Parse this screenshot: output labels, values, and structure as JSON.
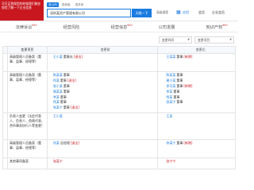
{
  "header": {
    "logo_text": "可可买到保险的时候我们能在保险了解一下企业信息",
    "search_tabs": [
      "查公司",
      "查老板",
      "查关系"
    ],
    "search_value": "深圳某资产管理有限公司",
    "search_button": "天眼一下",
    "advanced": "高级搜索",
    "links": [
      "应用",
      "会员",
      "企业会员"
    ]
  },
  "nav": {
    "items": [
      {
        "label": "法律诉讼",
        "count": "99+"
      },
      {
        "label": "经营风险",
        "count": ""
      },
      {
        "label": "经营信息",
        "count": "99+"
      },
      {
        "label": "公司发展",
        "count": ""
      },
      {
        "label": "知识产权",
        "count": "99+"
      }
    ]
  },
  "toolbar": {
    "filter1": "变更时间",
    "filter2": "变更项目"
  },
  "table": {
    "headers": [
      "",
      "变更项目",
      "变更前",
      "变更后"
    ],
    "rows": [
      {
        "type": "高级管理人员备案（董事、监事、经理等）",
        "before": [
          {
            "name": "王小某",
            "role": "董事长",
            "tag": "[退出]"
          }
        ],
        "after": [
          {
            "name": "王某某",
            "role": "董事",
            "tag": "[新增]"
          }
        ]
      },
      {
        "type": "高级管理人员备案（董事、监事、经理等）",
        "before": [
          {
            "name": "陈某某",
            "role": "董事",
            "tag": ""
          },
          {
            "name": "徐某",
            "role": "董事",
            "tag": "[退出]"
          },
          {
            "name": "张小某",
            "role": "董事",
            "tag": ""
          },
          {
            "name": "谢某某",
            "role": "董事",
            "tag": ""
          },
          {
            "name": "李某",
            "role": "董事",
            "tag": ""
          },
          {
            "name": "钱某",
            "role": "董事",
            "tag": ""
          },
          {
            "name": "张某宁",
            "role": "董事",
            "tag": "[退出]"
          }
        ],
        "after": [
          {
            "name": "陈某某",
            "role": "董事",
            "tag": ""
          },
          {
            "name": "谢小某",
            "role": "董事",
            "tag": ""
          },
          {
            "name": "徐可某",
            "role": "董事",
            "tag": "[新增]"
          },
          {
            "name": "李某",
            "role": "董事",
            "tag": ""
          },
          {
            "name": "钱某",
            "role": "董事",
            "tag": ""
          },
          {
            "name": "张某宁",
            "role": "董事",
            "tag": ""
          }
        ]
      },
      {
        "type": "负责人变更（法定代表人、负责人、首席代表、合伙事务执行人等变更）",
        "before": [
          {
            "name": "王小某",
            "role": "",
            "tag": ""
          }
        ],
        "after": [
          {
            "name": "王某",
            "role": "",
            "tag": ""
          }
        ]
      },
      {
        "type": "高级管理人员备案（董事、监事、经理等）",
        "before": [
          {
            "name": "徐某",
            "role": "总经理",
            "tag": "[退出]"
          }
        ],
        "after": [
          {
            "name": "李某宁",
            "role": "董事",
            "tag": "[新增]"
          }
        ]
      },
      {
        "type": "其他事项备案",
        "before": [
          {
            "name": "张某宁",
            "role": "",
            "tag": ""
          }
        ],
        "after": [
          {
            "name": "张宁宁",
            "role": "",
            "tag": ""
          }
        ]
      }
    ]
  },
  "colors": {
    "brand_red": "#c9171f",
    "link_blue": "#1a7be0"
  }
}
